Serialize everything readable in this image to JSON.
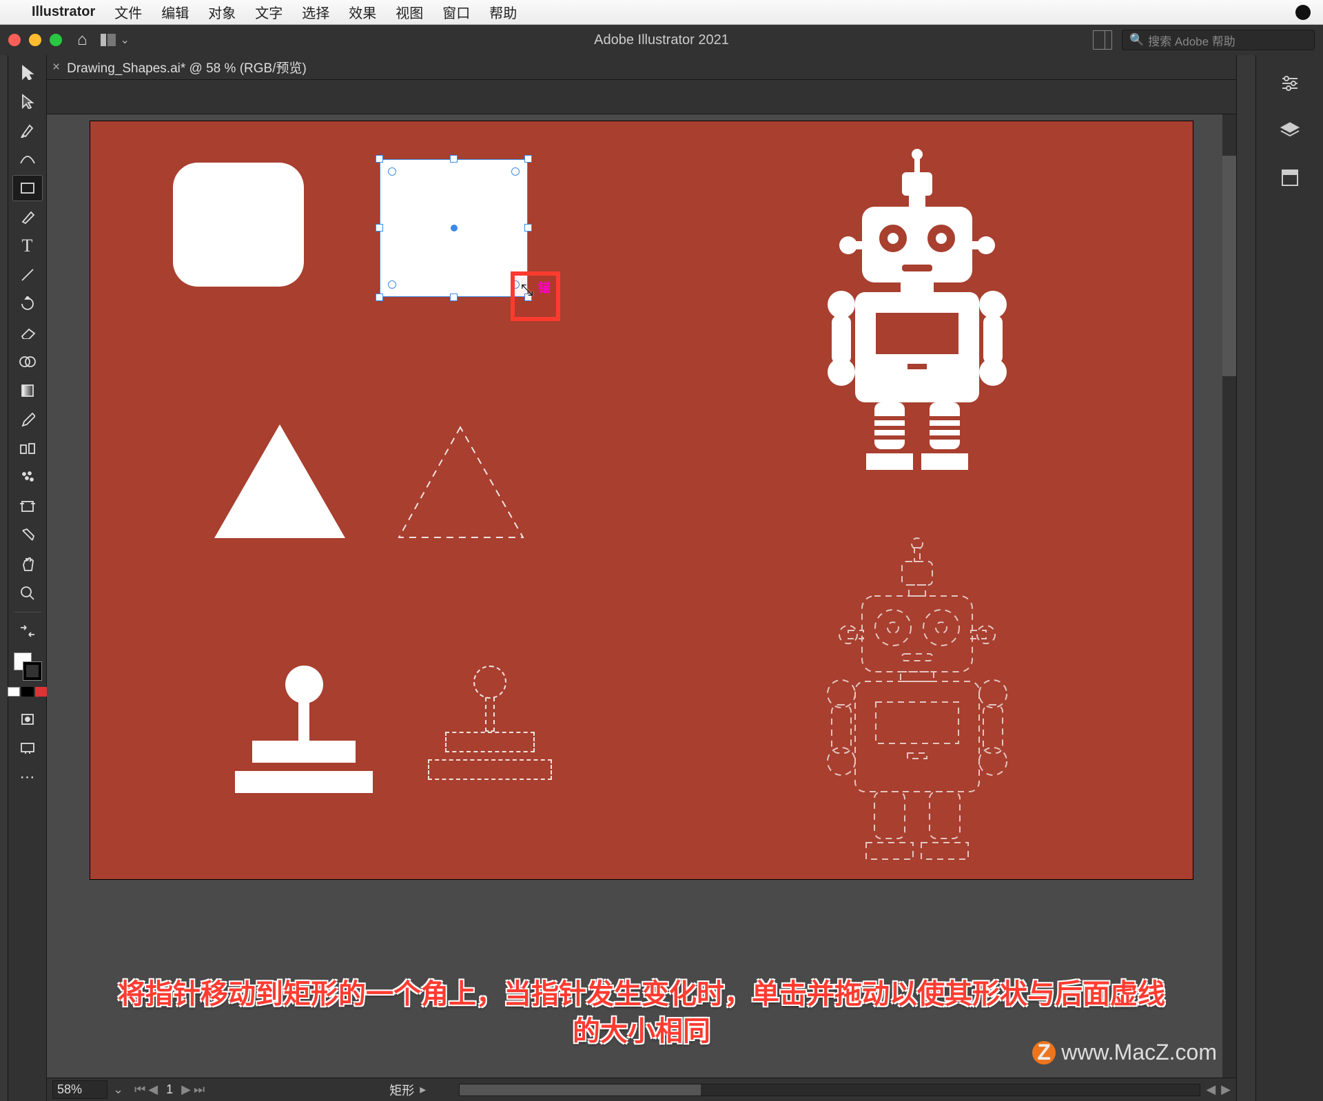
{
  "macos_menu": {
    "app_name": "Illustrator",
    "items": [
      "文件",
      "编辑",
      "对象",
      "文字",
      "选择",
      "效果",
      "视图",
      "窗口",
      "帮助"
    ]
  },
  "titlebar": {
    "app_title": "Adobe Illustrator 2021",
    "search_placeholder": "搜索 Adobe 帮助"
  },
  "document": {
    "tab_label": "Drawing_Shapes.ai* @ 58 % (RGB/预览)"
  },
  "status": {
    "zoom": "58%",
    "page": "1",
    "shape_label": "矩形"
  },
  "resize_hint": "锚",
  "tutorial": {
    "line1": "将指针移动到矩形的一个角上，当指针发生变化时，单击并拖动以使其形状与后面虚线",
    "line2": "的大小相同"
  },
  "watermark": "www.MacZ.com",
  "tools": {
    "list": [
      "selection",
      "direct-select",
      "pen",
      "curvature",
      "rectangle",
      "brush",
      "type",
      "line",
      "rotate",
      "eraser",
      "shape-builder",
      "gradient",
      "eyedropper",
      "blend",
      "symbol",
      "artboard",
      "slice",
      "hand",
      "zoom"
    ]
  },
  "right_panel": {
    "icons": [
      "properties",
      "layers",
      "libraries"
    ]
  },
  "colors": {
    "artboard_bg": "#a83f2f",
    "highlight": "#ff3b30",
    "selection": "#3b8ae6"
  }
}
